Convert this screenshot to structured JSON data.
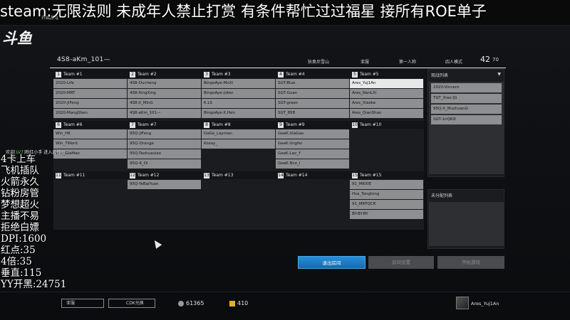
{
  "stream": {
    "banner": "steam:无限法则 未成年人禁止打赏 有条件帮忙过过福星 接所有ROE单子",
    "logo": "斗鱼",
    "welcome_prefix": "欢迎",
    "welcome_level": "[LV7]",
    "welcome_suffix": "粉红小手 进入直播间",
    "overlay_lines": [
      "4卡上车",
      "飞机插队",
      "火箭永久",
      "钻粉房管",
      "梦想超火",
      "主播不易",
      "拒绝白嫖",
      "DPI:1600",
      "红点:35",
      "4倍:35",
      "垂直:115",
      "YY开黑:24751"
    ]
  },
  "nav": {
    "tabs": [
      "开始游戏",
      "",
      "",
      "",
      "",
      "",
      "",
      ""
    ],
    "active_tab": 0
  },
  "room": {
    "name": "4S8-aKm_101—",
    "map": "狄奥尼雪山",
    "region": "亚服",
    "perspective": "第一人称",
    "mode": "四人模式",
    "player_count": "42",
    "player_max": "70"
  },
  "teams": [
    {
      "label": "Team #1",
      "num": "1",
      "players": [
        "2020-Life",
        "2020-MRT",
        "2020-JiFeng",
        "2020-MangShen"
      ]
    },
    {
      "label": "Team #2",
      "num": "2",
      "players": [
        "4S8-Oucheng",
        "4S8-XingXing",
        "4S8-X_MinG",
        "4S8-aKm_101—"
      ]
    },
    {
      "label": "Team #3",
      "num": "3",
      "players": [
        "BingoAye-MoXi",
        "BingoAye-Joker",
        "K.LS",
        "BingoAye-X.Hen"
      ]
    },
    {
      "label": "Team #4",
      "num": "4",
      "players": [
        "SGT-Blue.",
        "SGT-Guan",
        "SGT-green",
        "SGT_858"
      ]
    },
    {
      "label": "Team #5",
      "num": "5",
      "players": [
        "Ares_Yuj1An",
        "Ares_NanLXi",
        "Ares_Xiaoke",
        "Ares_QianShan"
      ]
    },
    {
      "label": "Team #6",
      "num": "6",
      "players": [
        "Win_HK",
        "Win_7Word",
        "Win_GiaMao"
      ]
    },
    {
      "label": "Team #7",
      "num": "7",
      "players": [
        "95Q-JiFeng",
        "95Q-Orange",
        "95Q-Taohuaxiao",
        "95Q-K_Di"
      ]
    },
    {
      "label": "Team #8",
      "num": "8",
      "players": [
        "DaGe_Layman",
        "Kozay_"
      ]
    },
    {
      "label": "Team #9",
      "num": "9",
      "players": [
        "GeeK.XiaGao",
        "GeeK.tingfei",
        "GeeK.Lao_Y",
        "GeeK.Nco_i"
      ]
    },
    {
      "label": "Team #10",
      "num": "10",
      "players": []
    },
    {
      "label": "Team #11",
      "num": "11",
      "players": []
    },
    {
      "label": "Team #12",
      "num": "12",
      "players": [
        "95Q-YeBaiYuan"
      ]
    },
    {
      "label": "Team #13",
      "num": "13",
      "players": []
    },
    {
      "label": "Team #14",
      "num": "14",
      "players": []
    },
    {
      "label": "Team #15",
      "num": "15",
      "players": [
        "91_MRXIE",
        "Hsa_Tongtong",
        "91_MRFQCR",
        "BY-BY-BY"
      ]
    }
  ],
  "spectators": {
    "title": "观战列表",
    "players": [
      "2020-Vincent",
      "TGT_Xiao.Qi",
      "95Q-X_MuzhuanG",
      "SGT-1nQKill"
    ]
  },
  "unassigned": {
    "title": "未分配列表",
    "players": []
  },
  "actions": {
    "leave": "退出房间",
    "settings": "房间设置",
    "start": "开始游戏"
  },
  "bottom": {
    "server_btn": "亚服",
    "cdk_btn": "CDK兑换",
    "coins": "61365",
    "gold": "410",
    "username": "Ares_Yuj1An"
  },
  "colors": {
    "accent_blue": "#2a8dd8",
    "slot_gray": "#8e8f91",
    "selected_slot": "#e8e8e8"
  }
}
